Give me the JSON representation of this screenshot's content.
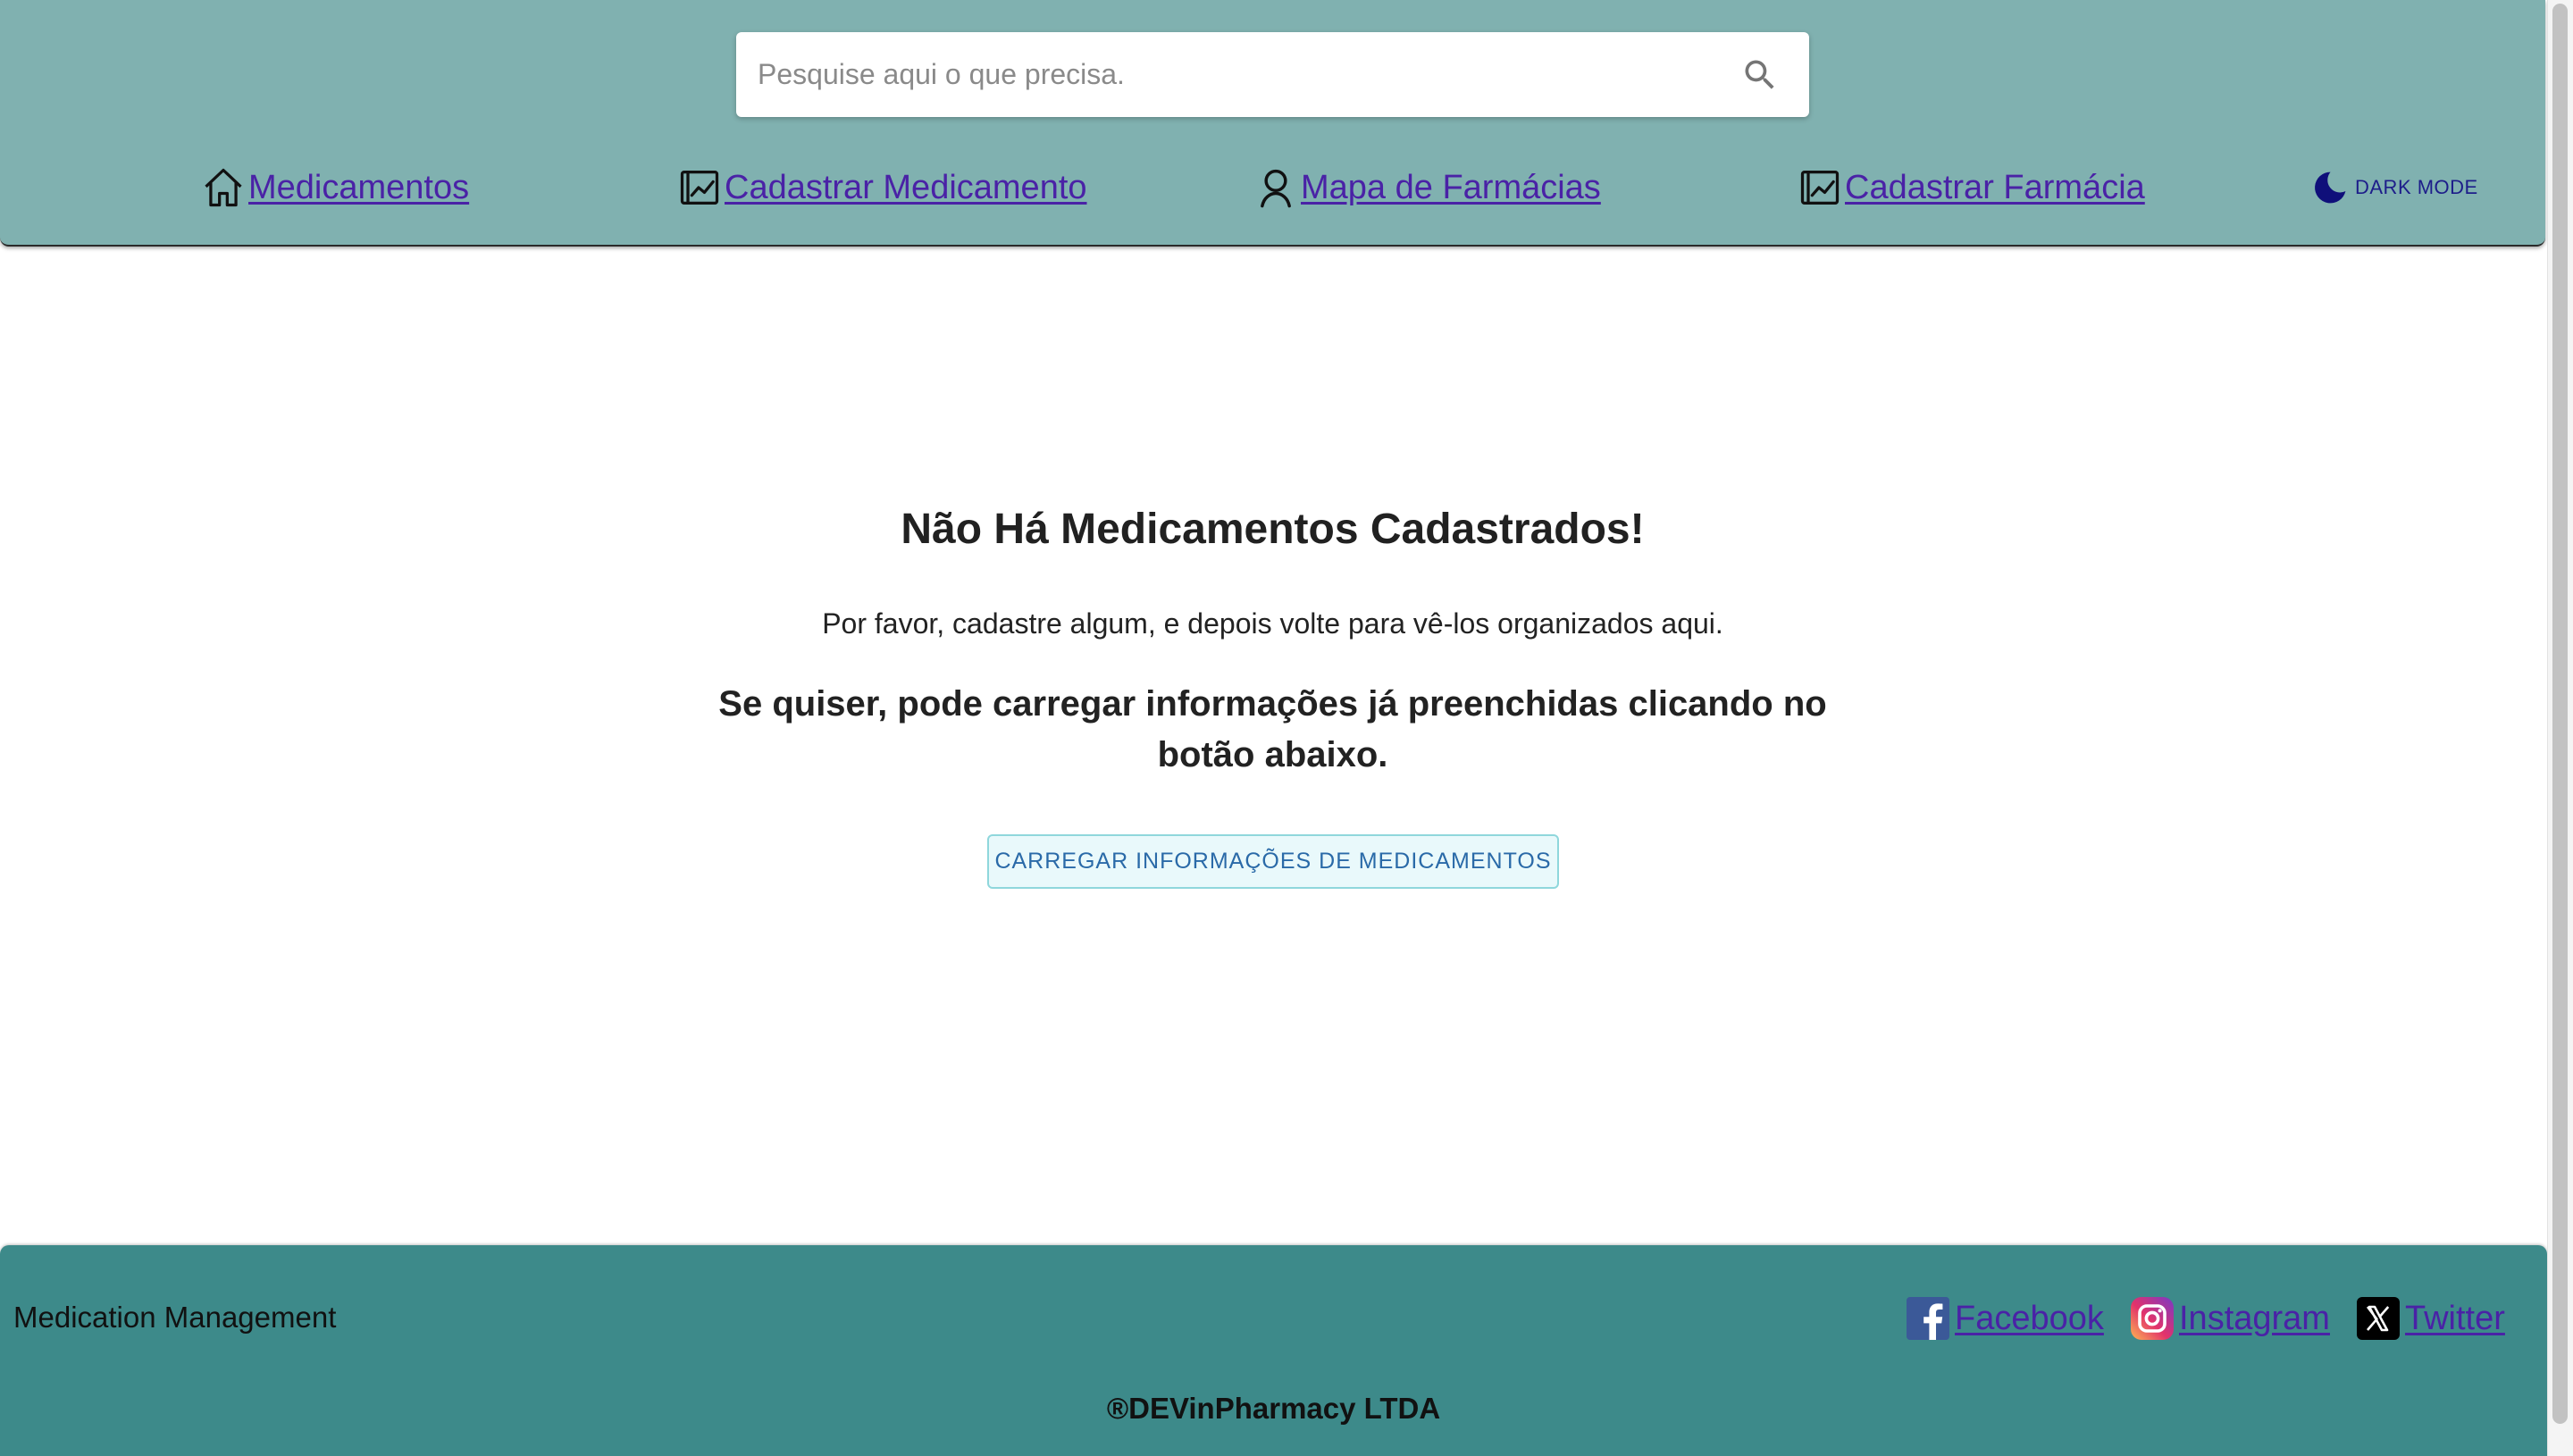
{
  "header": {
    "search": {
      "placeholder": "Pesquise aqui o que precisa."
    },
    "nav": [
      {
        "label": "Medicamentos",
        "icon": "home-icon"
      },
      {
        "label": "Cadastrar Medicamento",
        "icon": "chart-icon"
      },
      {
        "label": "Mapa de Farmácias",
        "icon": "person-icon"
      },
      {
        "label": "Cadastrar Farmácia",
        "icon": "chart-icon"
      }
    ],
    "dark_mode": {
      "label": "DARK MODE",
      "icon": "moon-icon"
    }
  },
  "main": {
    "title": "Não Há Medicamentos Cadastrados!",
    "message": "Por favor, cadastre algum, e depois volte para vê-los organizados aqui.",
    "hint": "Se quiser, pode carregar informações já preenchidas clicando no botão abaixo.",
    "load_button": "CARREGAR INFORMAÇÕES DE MEDICAMENTOS"
  },
  "footer": {
    "brand": "Medication Management",
    "social": [
      {
        "label": "Facebook",
        "icon": "facebook-icon"
      },
      {
        "label": "Instagram",
        "icon": "instagram-icon"
      },
      {
        "label": "Twitter",
        "icon": "x-twitter-icon"
      }
    ],
    "copyright": "®DEVinPharmacy LTDA"
  },
  "colors": {
    "header_bg": "#80b1b0",
    "footer_bg": "#3d8a8a",
    "link": "#4a22a6",
    "button_bg": "#e9f9fb",
    "button_text": "#2a6aa8"
  }
}
